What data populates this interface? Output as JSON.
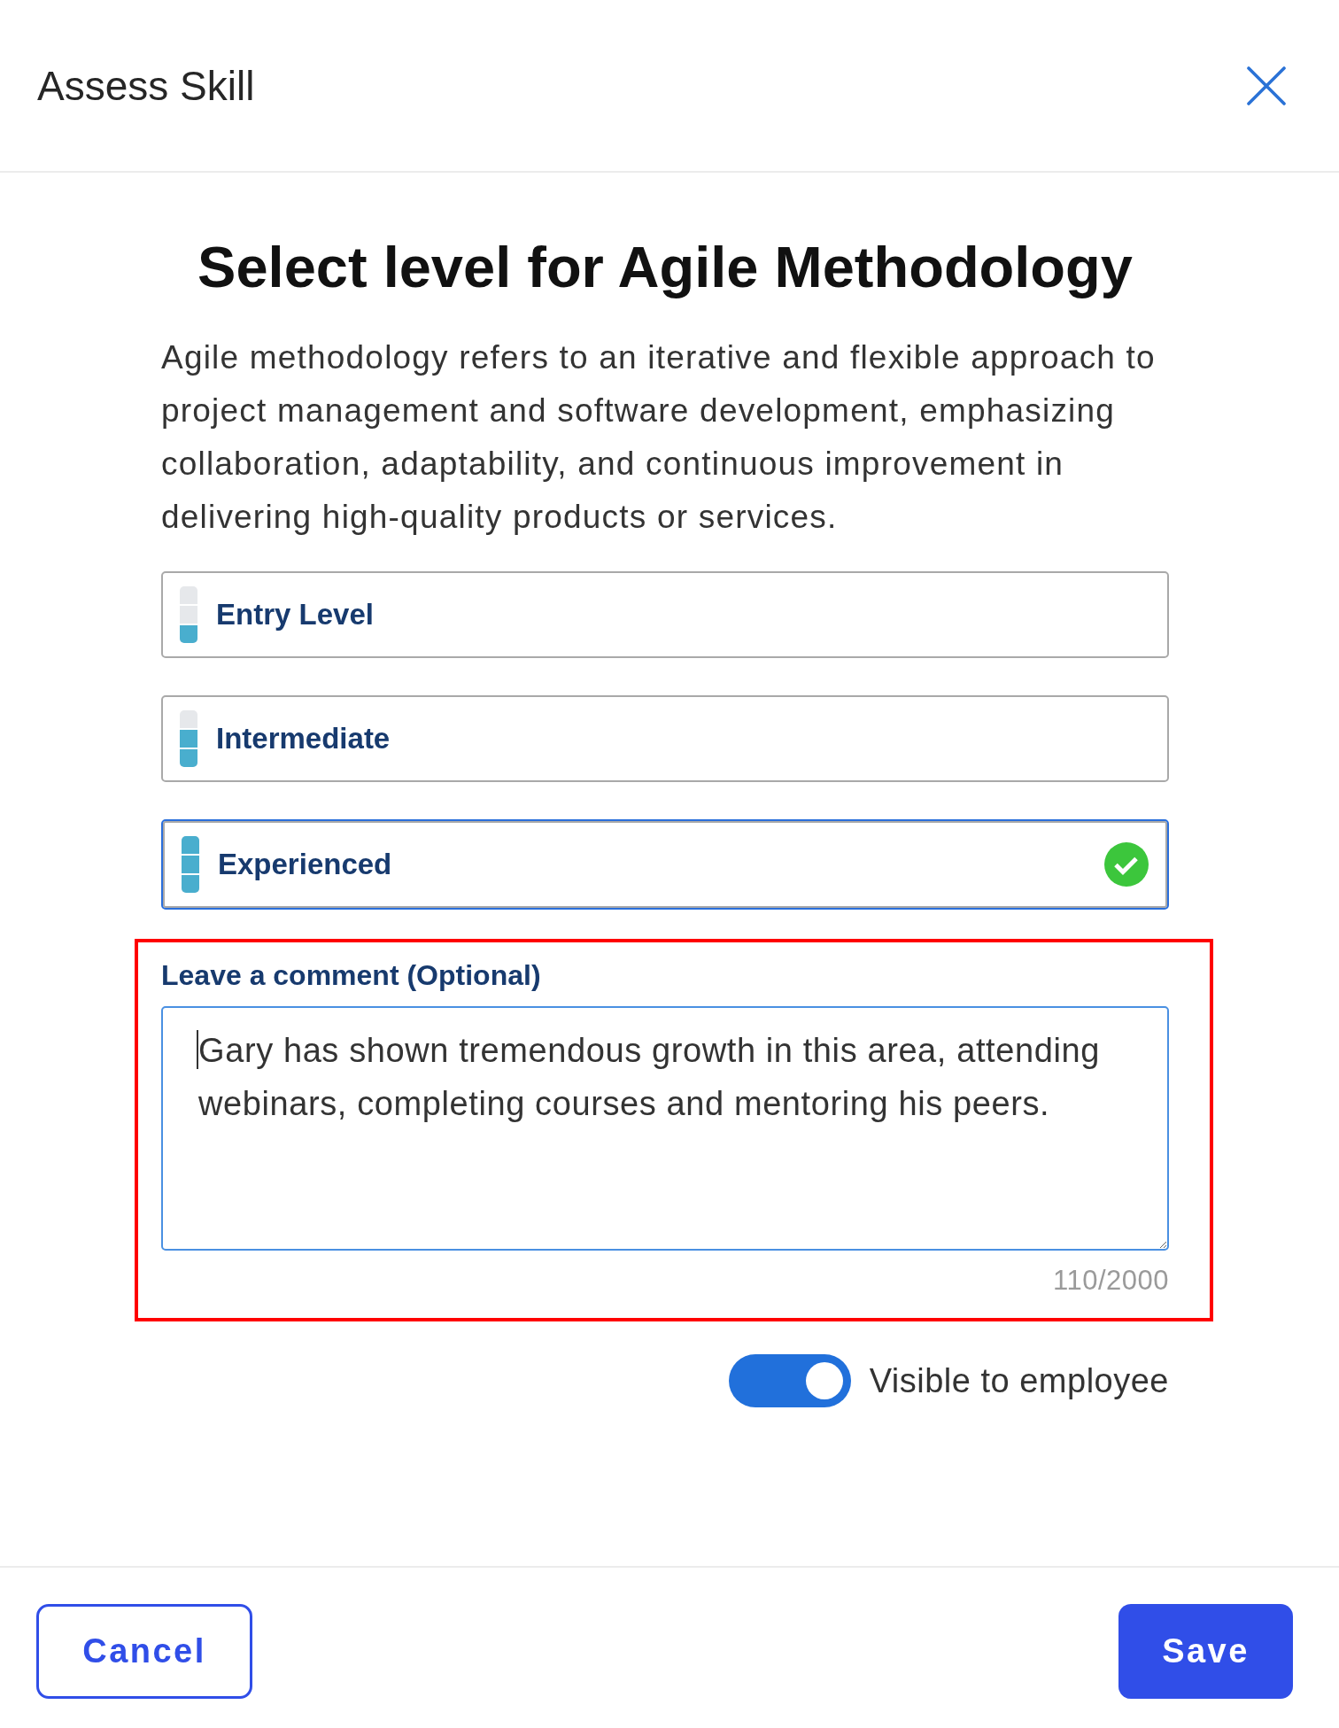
{
  "dialog": {
    "title": "Assess Skill"
  },
  "heading": "Select level for Agile Methodology",
  "description": "Agile methodology refers to an iterative and flexible approach to project management and software development, emphasizing collaboration, adaptability, and continuous improvement in delivering high-quality products or services.",
  "levels": [
    {
      "label": "Entry Level",
      "level": 0.33,
      "selected": false
    },
    {
      "label": "Intermediate",
      "level": 0.67,
      "selected": false
    },
    {
      "label": "Experienced",
      "level": 1,
      "selected": true
    }
  ],
  "comment": {
    "label": "Leave a comment (Optional)",
    "value": "Gary has shown tremendous growth in this area, attending webinars, completing courses and mentoring his peers.",
    "focused": true,
    "counter": "110/2000",
    "highlighted": true
  },
  "visibility": {
    "label": "Visible to employee",
    "on": true
  },
  "buttons": [
    {
      "label": "Cancel",
      "kind": "secondary"
    },
    {
      "label": "Save",
      "kind": "primary"
    }
  ]
}
